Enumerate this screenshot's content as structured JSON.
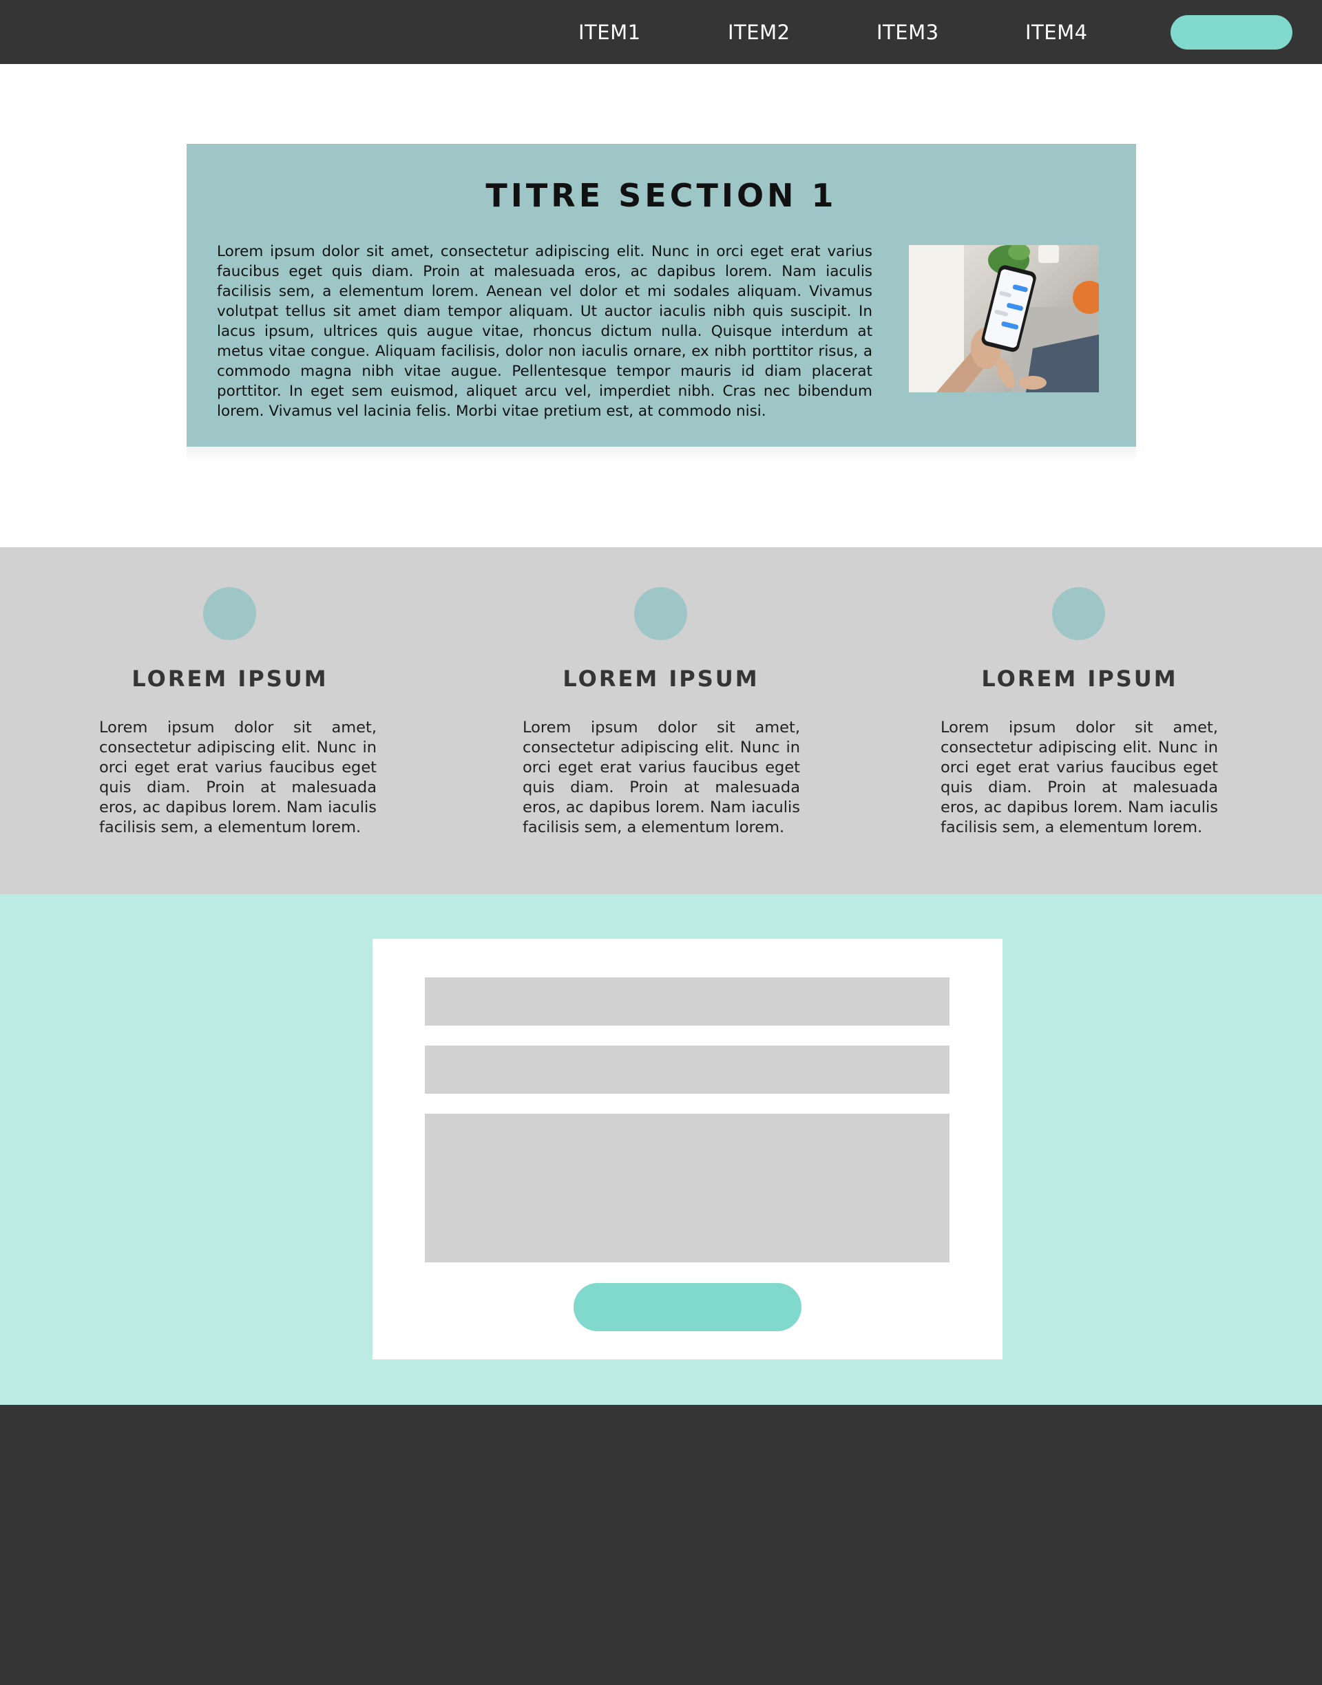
{
  "header": {
    "nav": [
      {
        "label": "ITEM1"
      },
      {
        "label": "ITEM2"
      },
      {
        "label": "ITEM3"
      },
      {
        "label": "ITEM4"
      }
    ],
    "cta_label": ""
  },
  "section1": {
    "title": "TITRE SECTION 1",
    "text": "Lorem ipsum dolor sit amet, consectetur adipiscing elit. Nunc in orci eget erat varius faucibus eget quis diam. Proin at malesuada eros, ac dapibus lorem. Nam iaculis facilisis sem, a elementum lorem. Aenean vel dolor et mi sodales aliquam. Vivamus volutpat tellus sit amet diam tempor aliquam. Ut auctor iaculis nibh quis suscipit. In lacus ipsum, ultrices quis augue vitae, rhoncus dictum nulla. Quisque interdum at metus vitae congue. Aliquam facilisis, dolor non iaculis ornare, ex nibh porttitor risus, a commodo magna nibh vitae augue. Pellentesque tempor mauris id diam placerat porttitor. In eget sem euismod, aliquet arcu vel, imperdiet nibh. Cras nec bibendum lorem. Vivamus vel lacinia felis. Morbi vitae pretium est, at commodo nisi.",
    "image_icon": "hand-holding-phone-photo"
  },
  "features": [
    {
      "title": "LOREM IPSUM",
      "text": "Lorem ipsum dolor sit amet, consectetur adipiscing elit. Nunc in orci eget erat varius faucibus eget quis diam. Proin at malesuada eros, ac dapibus lorem. Nam iaculis facilisis sem, a elementum lorem."
    },
    {
      "title": "LOREM IPSUM",
      "text": "Lorem ipsum dolor sit amet, consectetur adipiscing elit. Nunc in orci eget erat varius faucibus eget quis diam. Proin at malesuada eros, ac dapibus lorem. Nam iaculis facilisis sem, a elementum lorem."
    },
    {
      "title": "LOREM IPSUM",
      "text": "Lorem ipsum dolor sit amet, consectetur adipiscing elit. Nunc in orci eget erat varius faucibus eget quis diam. Proin at malesuada eros, ac dapibus lorem. Nam iaculis facilisis sem, a elementum lorem."
    }
  ],
  "contact": {
    "field1_value": "",
    "field2_value": "",
    "message_value": "",
    "submit_label": ""
  },
  "colors": {
    "dark": "#353535",
    "accent": "#81d8cc",
    "section_teal": "#9fc6c7",
    "contact_bg": "#bcebe4",
    "feature_bg": "#d1d1d1"
  }
}
